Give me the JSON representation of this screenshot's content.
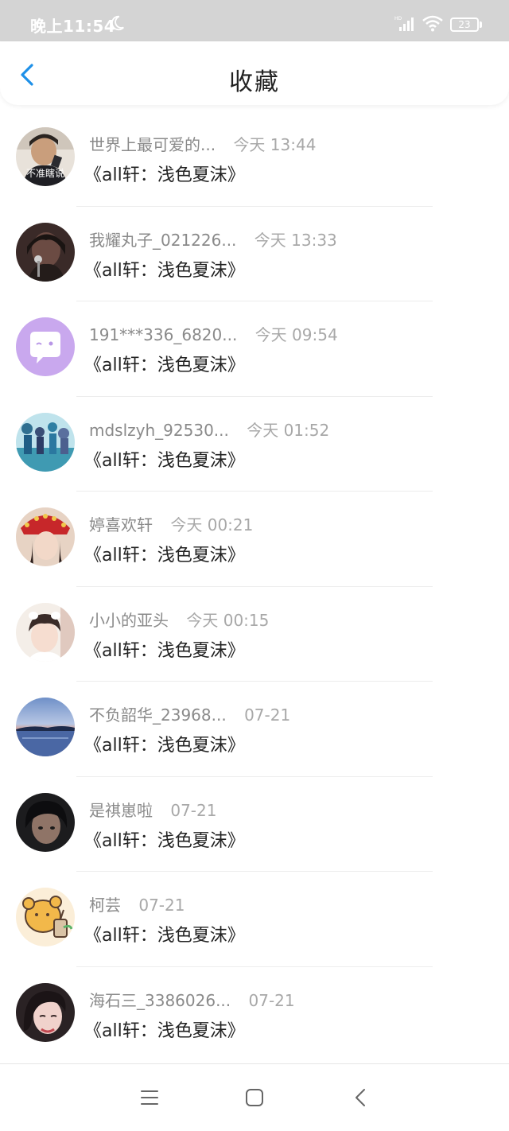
{
  "status_bar": {
    "time": "晚上11:54",
    "battery": "23",
    "icons": [
      "moon-icon",
      "signal-icon",
      "wifi-icon",
      "battery-icon"
    ]
  },
  "header": {
    "title": "收藏",
    "back_icon": "chevron-left-icon"
  },
  "items": [
    {
      "user": "世界上最可爱的...",
      "time": "今天 13:44",
      "title": "《all轩：浅色夏沫》"
    },
    {
      "user": "我耀丸子_021226...",
      "time": "今天 13:33",
      "title": "《all轩：浅色夏沫》"
    },
    {
      "user": "191***336_6820...",
      "time": "今天 09:54",
      "title": "《all轩：浅色夏沫》"
    },
    {
      "user": "mdslzyh_92530...",
      "time": "今天 01:52",
      "title": "《all轩：浅色夏沫》"
    },
    {
      "user": "婷喜欢轩",
      "time": "今天 00:21",
      "title": "《all轩：浅色夏沫》"
    },
    {
      "user": "小小的亚头",
      "time": "今天 00:15",
      "title": "《all轩：浅色夏沫》"
    },
    {
      "user": "不负韶华_23968...",
      "time": "07-21",
      "title": "《all轩：浅色夏沫》"
    },
    {
      "user": "是祺崽啦",
      "time": "07-21",
      "title": "《all轩：浅色夏沫》"
    },
    {
      "user": "柯芸",
      "time": "07-21",
      "title": "《all轩：浅色夏沫》"
    },
    {
      "user": "海石三_3386026...",
      "time": "07-21",
      "title": "《all轩：浅色夏沫》"
    }
  ],
  "avatar_badge_text": "不准瞎说",
  "bottom_nav": {
    "icons": [
      "menu-icon",
      "home-square-icon",
      "back-triangle-icon"
    ]
  },
  "colors": {
    "accent": "#1e90e8",
    "status_bar_bg": "#d4d4d4",
    "text_primary": "#222222",
    "text_secondary": "#8f8f8f"
  }
}
